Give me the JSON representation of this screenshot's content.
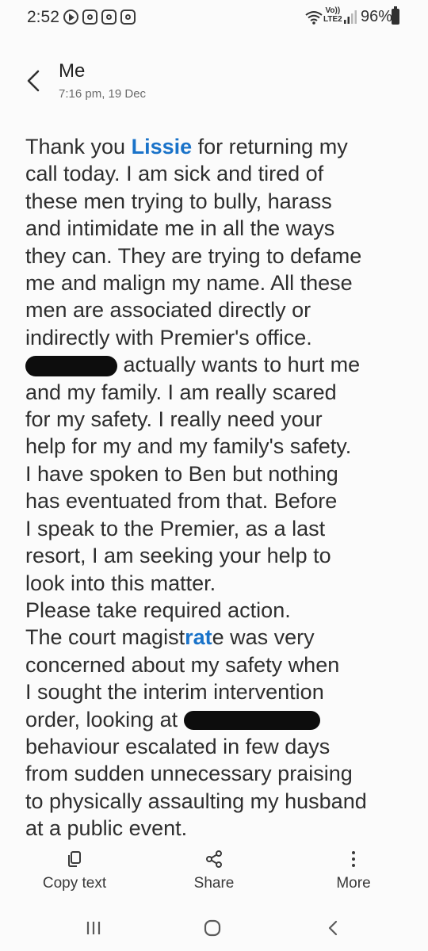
{
  "status_bar": {
    "time": "2:52",
    "network_label_top": "Vo))",
    "network_label_bottom": "LTE2",
    "battery_percent": "96%",
    "notification_icons": [
      "play-circle-icon",
      "instagram-icon",
      "instagram-icon",
      "instagram-icon"
    ]
  },
  "header": {
    "contact": "Me",
    "datetime": "7:16 pm, 19 Dec"
  },
  "message": {
    "l1a": "Thank you ",
    "l1_name": "Lissie",
    "l1b": " for returning my",
    "l2": "call today. I am sick and tired of",
    "l3": "these men trying to bully, harass",
    "l4": "and intimidate me in all the ways",
    "l5": "they can. They are trying to defame",
    "l6": "me and malign my name. All these",
    "l7": "men are associated directly or",
    "l8": "indirectly with Premier's office.",
    "l9": " actually  wants to hurt me",
    "l10": "and my family. I am really scared",
    "l11": "for my safety. I really need your",
    "l12": "help for my and my family's safety.",
    "l13": "I have spoken to Ben but nothing",
    "l14": "has eventuated from that. Before",
    "l15": "I speak to the Premier, as a last",
    "l16": "resort, I am seeking your help to",
    "l17": "look into this matter.",
    "l18": "Please take required action.",
    "l19a": "The court magist",
    "l19_hl": "rat",
    "l19b": "e was very",
    "l20": "concerned about my safety when",
    "l21": "I sought the interim intervention",
    "l22": "order, looking at ",
    "l23": "behaviour escalated in few days",
    "l24": "from sudden unnecessary praising",
    "l25": "to physically assaulting my husband",
    "l26": "at a public event."
  },
  "actions": {
    "copy": "Copy text",
    "share": "Share",
    "more": "More"
  },
  "colors": {
    "link_blue": "#1a73c9",
    "background": "#fbfbfb",
    "text": "#2e2e2e"
  }
}
